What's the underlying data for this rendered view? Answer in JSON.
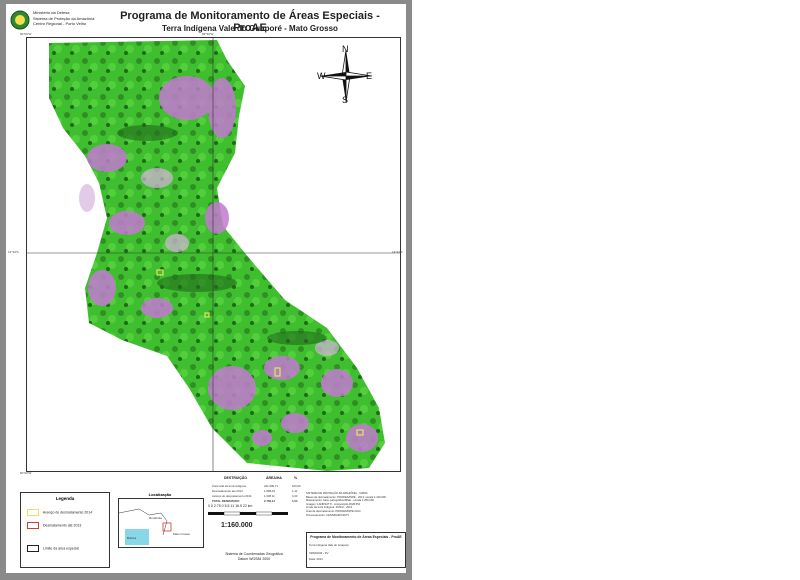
{
  "header": {
    "agency_lines": [
      "Ministério da Defesa",
      "Sistema de Proteção da Amazônia",
      "Centro Regional - Porto Velho"
    ],
    "title": "Programa de Monitoramento de Áreas Especiais - ProAE",
    "subtitle": "Terra Indígena Vale do Guaporé - Mato Grosso"
  },
  "map": {
    "compass": {
      "n": "N",
      "s": "S",
      "e": "E",
      "w": "W"
    },
    "colors": {
      "forest": "#3fbf2f",
      "deforested": "#c27ad0",
      "dark_forest": "#1f6a1a",
      "water": "#88d7e8"
    },
    "coords": [
      "60°00'W",
      "59°30'W",
      "14°30'S",
      "14°30'S",
      "15°00'S",
      "60°00'W"
    ]
  },
  "legend": {
    "title": "Legenda",
    "items": [
      {
        "label": "Avanço do desmatamento 2014",
        "color": "#e7e35c"
      },
      {
        "label": "Desmatamento até 2013",
        "color": "#d23939"
      },
      {
        "label": "Limite da área especial",
        "color": "#222222"
      }
    ]
  },
  "location_map": {
    "title": "Localização",
    "labels": [
      "Rondônia",
      "Mato Grosso",
      "Bolívia"
    ]
  },
  "scale": {
    "ticks": [
      "0.0",
      "2.75",
      "0",
      "5.5",
      "11",
      "16.5",
      "22",
      "km"
    ],
    "ratio": "1:160.000",
    "datum_lines": [
      "Sistema de Coordenadas Geográfica",
      "Datum WGS84 2000"
    ]
  },
  "table": {
    "headers": [
      "DESTRUIÇÃO",
      "ÁREA/HA",
      "%"
    ],
    "rows": [
      [
        "Área total da terra indígena",
        "241.609,71",
        "100,00"
      ],
      [
        "Desmatamento até 2013",
        "1.698,03",
        "1,11"
      ],
      [
        "Avanço do desmatamento 2014",
        "1.038,11",
        "0,43"
      ],
      [
        "TOTAL DESMATADO",
        "2.736,14",
        "1,54"
      ]
    ]
  },
  "notes": [
    "SISTEMA DE PROTEÇÃO DA AMAZÔNIA - SIPAM",
    "Bases de desmatamento: PRODES/INPE - 2013; escala 1:100.000",
    "Mapeamento: base cartográfica IBGE - escala 1:250.000",
    "Imagem: LANDSAT 8 - composição RGB 654",
    "Limite da terra indígena: FUNAI - 2013",
    "Área de desmatamento: PRODES/INPE 2014",
    "Processamento: CENSIPAM/CR-PV"
  ],
  "title_box": {
    "title": "Programa de Monitoramento de Áreas Especiais - ProAE",
    "line1": "Terra Indígena Vale do Guaporé",
    "line2": "SIPAM/CR - PV",
    "line3": "Data: 2014"
  }
}
